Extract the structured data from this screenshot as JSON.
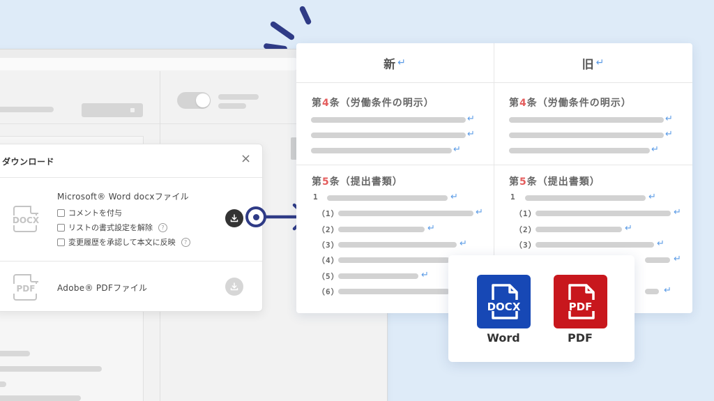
{
  "dialog": {
    "title": "ダウンロード",
    "close_icon": "×",
    "word_option": {
      "icon_label": "DOCX",
      "title": "Microsoft® Word docxファイル",
      "checkboxes": [
        {
          "label": "コメントを付与",
          "checked": false,
          "help": false
        },
        {
          "label": "リストの書式設定を解除",
          "checked": false,
          "help": true
        },
        {
          "label": "変更履歴を承認して本文に反映",
          "checked": false,
          "help": true
        }
      ],
      "help_glyph": "?"
    },
    "pdf_option": {
      "icon_label": "PDF",
      "title": "Adobe® PDFファイル"
    }
  },
  "compare": {
    "columns": [
      {
        "header": "新",
        "return_mark": "↵"
      },
      {
        "header": "旧",
        "return_mark": "↵"
      }
    ],
    "articles": [
      {
        "prefix": "第",
        "number": "4",
        "suffix": "条（労働条件の明示）"
      },
      {
        "prefix": "第",
        "number": "5",
        "suffix": "条（提出書類）"
      }
    ],
    "items": [
      "1",
      "（1）",
      "（2）",
      "（3）",
      "（4）",
      "（5）",
      "（6）"
    ],
    "return_mark": "↵"
  },
  "formats": [
    {
      "label": "Word",
      "icon_text": "DOCX",
      "color": "#1748b5"
    },
    {
      "label": "PDF",
      "icon_text": "PDF",
      "color": "#c8171d"
    }
  ],
  "colors": {
    "accent": "#2f3b86",
    "article_number": "#e45d5d",
    "return_mark": "#5b9be6",
    "download_active": "#333333",
    "download_disabled": "#d6d6d6"
  }
}
